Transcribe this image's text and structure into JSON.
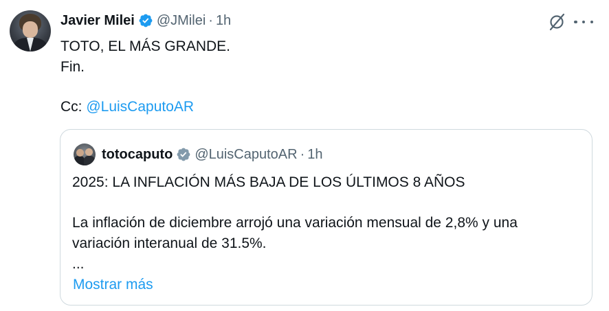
{
  "author": {
    "name": "Javier Milei",
    "handle": "@JMilei",
    "separator": "·",
    "time": "1h",
    "verified_color": "#1d9bf0"
  },
  "tweet": {
    "line1": "TOTO, EL MÁS GRANDE.",
    "line2": "Fin.",
    "cc_prefix": "Cc: ",
    "cc_mention": "@LuisCaputoAR"
  },
  "quote": {
    "name": "totocaputo",
    "handle": "@LuisCaputoAR",
    "separator": "·",
    "time": "1h",
    "verified_color": "#829aab",
    "headline": "2025: LA INFLACIÓN MÁS BAJA DE LOS ÚLTIMOS 8 AÑOS",
    "para_line1": "La inflación de diciembre arrojó una variación mensual de 2,8% y una",
    "para_line2": "variación interanual de 31.5%.",
    "ellipsis": "...",
    "show_more": "Mostrar más"
  },
  "icons": {
    "grok": "grok-icon",
    "more": "more-options-icon",
    "verified": "verified-badge-icon"
  },
  "colors": {
    "link": "#1d9bf0",
    "secondary_text": "#536471",
    "border": "#cfd9de"
  }
}
